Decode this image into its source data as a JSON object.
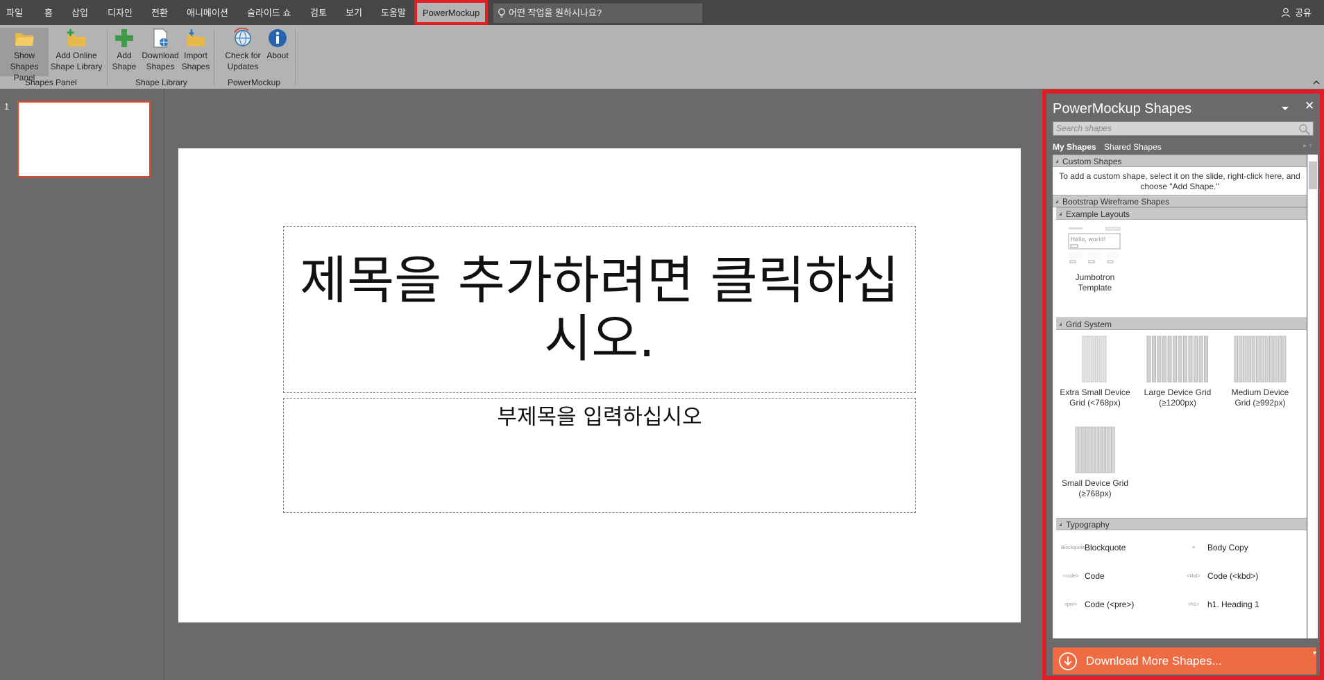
{
  "ribbon_tabs": [
    "파일",
    "홈",
    "삽입",
    "디자인",
    "전환",
    "애니메이션",
    "슬라이드 쇼",
    "검토",
    "보기",
    "도움말"
  ],
  "active_tab": "PowerMockup",
  "tell_me": "어떤 작업을 원하시나요?",
  "share": "공유",
  "ribbon": {
    "show_shapes_panel": "Show Shapes Panel",
    "add_online_library": "Add Online Shape Library",
    "add_shape": "Add Shape",
    "download_shapes": "Download Shapes",
    "import_shapes": "Import Shapes",
    "check_updates": "Check for Updates",
    "about": "About",
    "groups": [
      "Shapes Panel",
      "Shape Library",
      "PowerMockup"
    ]
  },
  "slides": {
    "number": "1"
  },
  "slide": {
    "title_placeholder": "제목을 추가하려면 클릭하십시오.",
    "subtitle_placeholder": "부제목을 입력하십시오"
  },
  "panel": {
    "title": "PowerMockup Shapes",
    "close": "✕",
    "search_placeholder": "Search shapes",
    "tab_my": "My Shapes",
    "tab_shared": "Shared Shapes",
    "sections": {
      "custom": "Custom Shapes",
      "custom_info": "To add a custom shape, select it on the slide, right-click here, and choose \"Add Shape.\"",
      "bootstrap": "Bootstrap Wireframe Shapes",
      "example_layouts": "Example Layouts",
      "grid_system": "Grid System",
      "typography": "Typography"
    },
    "shapes": {
      "jumbotron": "Jumbotron Template",
      "jumbotron_preview": "Hello, world!",
      "xs_grid": "Extra Small Device Grid (<768px)",
      "lg_grid": "Large Device Grid (≥1200px)",
      "md_grid": "Medium Device Grid (≥992px)",
      "sm_grid": "Small Device Grid (≥768px)"
    },
    "typography": [
      "Blockquote",
      "Body Copy",
      "Code",
      "Code (<kbd>)",
      "Code (<pre>)",
      "h1. Heading 1"
    ],
    "typography_minis": [
      "Blockquote",
      "",
      "<code>",
      "<kbd>",
      "<pre>",
      "<h1>"
    ],
    "download": "Download More Shapes..."
  },
  "colors": {
    "highlight": "#e11d26",
    "download_bg": "#ee6b44",
    "thumb_border": "#e6492a"
  }
}
